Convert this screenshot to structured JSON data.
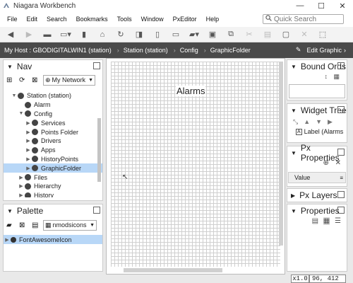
{
  "window": {
    "title": "Niagara Workbench",
    "min": "—",
    "max": "☐",
    "close": "✕"
  },
  "menu": [
    "File",
    "Edit",
    "Search",
    "Bookmarks",
    "Tools",
    "Window",
    "PxEditor",
    "Help"
  ],
  "search": {
    "placeholder": "Quick Search"
  },
  "path": {
    "segments": [
      "My Host : GBODIGITALWIN1 (station)",
      "Station (station)",
      "Config",
      "GraphicFolder"
    ],
    "edit_label": "Edit Graphic"
  },
  "nav": {
    "title": "Nav",
    "network": "My Network",
    "tree": [
      {
        "label": "Station (station)",
        "indent": 1,
        "tw": "▼",
        "icon": "station-icon"
      },
      {
        "label": "Alarm",
        "indent": 2,
        "tw": "",
        "icon": "alarm-icon"
      },
      {
        "label": "Config",
        "indent": 2,
        "tw": "▼",
        "icon": "config-icon"
      },
      {
        "label": "Services",
        "indent": 3,
        "tw": "▶",
        "icon": "services-icon"
      },
      {
        "label": "Points Folder",
        "indent": 3,
        "tw": "▶",
        "icon": "folder-icon"
      },
      {
        "label": "Drivers",
        "indent": 3,
        "tw": "▶",
        "icon": "drivers-icon"
      },
      {
        "label": "Apps",
        "indent": 3,
        "tw": "▶",
        "icon": "apps-icon"
      },
      {
        "label": "HistoryPoints",
        "indent": 3,
        "tw": "▶",
        "icon": "history-icon"
      },
      {
        "label": "GraphicFolder",
        "indent": 3,
        "tw": "▶",
        "icon": "folder-icon",
        "selected": true
      },
      {
        "label": "Files",
        "indent": 2,
        "tw": "▶",
        "icon": "files-icon"
      },
      {
        "label": "Hierarchy",
        "indent": 2,
        "tw": "▶",
        "icon": "hierarchy-icon"
      },
      {
        "label": "History",
        "indent": 2,
        "tw": "▶",
        "icon": "history-icon"
      }
    ]
  },
  "palette": {
    "title": "Palette",
    "module": "nmodsicons",
    "items": [
      {
        "label": "FontAwesomeIcon",
        "selected": true
      }
    ]
  },
  "canvas": {
    "label": "Alarms"
  },
  "right": {
    "bound_ords": "Bound Ords",
    "widget_tree": "Widget Tree",
    "widget_item": "Label (Alarms",
    "px_properties": "Px Properties",
    "value_label": "Value",
    "px_layers": "Px Layers",
    "properties": "Properties"
  },
  "status": {
    "zoom": "x1.0",
    "coords": "96, 412"
  },
  "colors": {
    "selection": "#b8d7f7",
    "pathbar": "#4a4a4a"
  }
}
